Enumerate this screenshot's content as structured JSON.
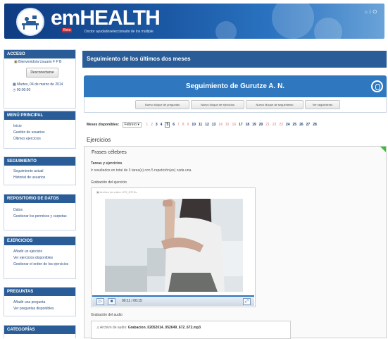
{
  "header": {
    "brand": "emHEALTH",
    "brand_badge": "Beta",
    "tagline": "Doctor ayudadoseleccionado de los multiple"
  },
  "sidebar": {
    "access": {
      "title": "ACCESO",
      "welcome": "Bienvenido/a Usuario F P B",
      "logout": "Desconectarse",
      "date": "Martes, 04 de marzo de 2014",
      "time": "00:00:00"
    },
    "main_menu": {
      "title": "MENÚ PRINCIPAL",
      "items": [
        "Inicio",
        "Gestión de usuarios",
        "Últimos ejercicios"
      ]
    },
    "tracking": {
      "title": "SEGUIMIENTO",
      "items": [
        "Seguimiento actual",
        "Historial de usuarios"
      ]
    },
    "data": {
      "title": "REPOSITORIO DE DATOS",
      "items": [
        "Datos",
        "Gestionar los permisos y carpetas"
      ]
    },
    "exercises": {
      "title": "EJERCICIOS",
      "items": [
        "Añadir un ejercicio",
        "Ver ejercicios disponibles",
        "Gestionar el orden de los ejercicios"
      ]
    },
    "questions": {
      "title": "PREGUNTAS",
      "items": [
        "Añadir una pregunta",
        "Ver preguntas disponibles"
      ]
    },
    "categories": {
      "title": "CATEGORÍAS"
    }
  },
  "main": {
    "title": "Seguimiento de los últimos dos meses",
    "banner": "Seguimiento de Gurutze A. N.",
    "buttons": [
      "Nuevo bloque de preguntas",
      "Nuevo bloque de ejercicios",
      "Nuevo bloque de seguimiento",
      "Ver seguimiento"
    ],
    "available_label": "Meses disponibles:",
    "select_value": "Febrero",
    "pages": [
      "1",
      "2",
      "3",
      "4",
      "5",
      "6",
      "7",
      "8",
      "9",
      "10",
      "11",
      "12",
      "13",
      "14",
      "15",
      "16",
      "17",
      "18",
      "19",
      "20",
      "21",
      "22",
      "23",
      "24",
      "25",
      "26",
      "27",
      "28"
    ],
    "section": "Ejercicios",
    "exercise_title": "Frases célebres",
    "tests_heading": "Tareas y ejercicios",
    "tests_text": "Ir resultados en total de 3 tarea(s) con 5 repetición(es) cada una.",
    "video_label": "Grabación del ejercicio",
    "video_file": "Archivo de vídeo: 672_672.flv",
    "video_time": "00:11 / 00:15",
    "audio_label": "Grabación del audio",
    "audio_file_label": "Archivo de audio:",
    "audio_file": "Grabacion_02052014_052649_672_672.mp3"
  },
  "colors": {
    "primary": "#2a5d97",
    "banner": "#2f78bf",
    "accent_green": "#3cbe3c"
  }
}
